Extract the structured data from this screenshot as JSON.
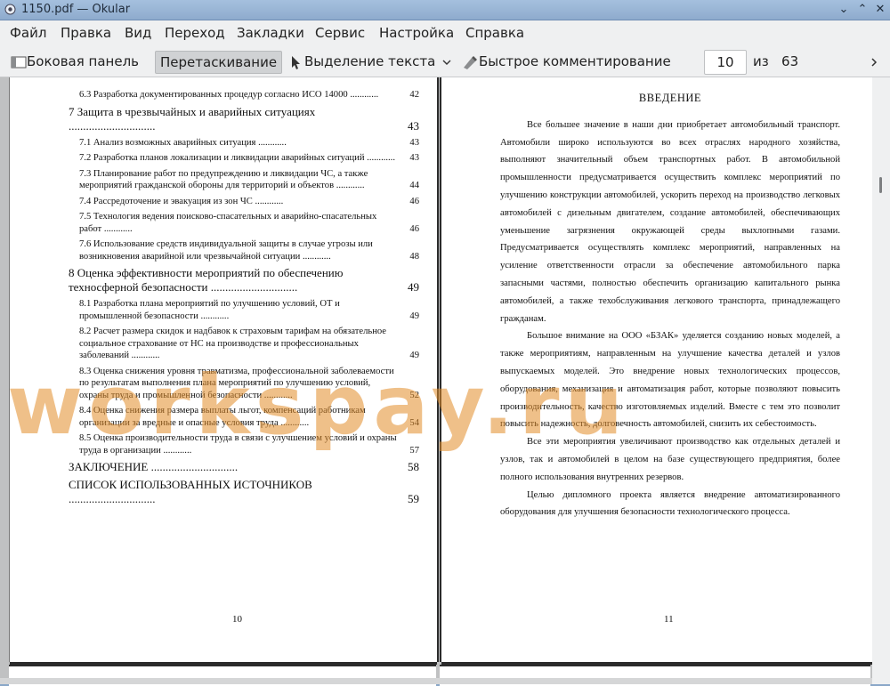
{
  "window": {
    "title": "1150.pdf — Okular"
  },
  "menu": [
    "Файл",
    "Правка",
    "Вид",
    "Переход",
    "Закладки",
    "Сервис",
    "Настройка",
    "Справка"
  ],
  "toolbar": {
    "sidebar": "Боковая панель",
    "drag": "Перетаскивание",
    "select_text": "Выделение текста",
    "quick_comment": "Быстрое комментирование",
    "current_page": "10",
    "of_label": "из",
    "total_pages": "63"
  },
  "left_page": {
    "page_number": "10",
    "toc": [
      {
        "text": "6.3  Разработка документированных процедур согласно ИСО 14000",
        "page": "42",
        "level": 2
      },
      {
        "text": "7   Защита в чрезвычайных и аварийных ситуациях",
        "page": "43",
        "level": 1
      },
      {
        "text": "7.1   Анализ возможных аварийных ситуация",
        "page": "43",
        "level": 2
      },
      {
        "text": "7.2   Разработка планов локализации и ликвидации аварийных ситуаций",
        "page": "43",
        "level": 2
      },
      {
        "text": "7.3   Планирование работ по предупреждению и ликвидации ЧС, а также мероприятий гражданской обороны для территорий и объектов",
        "page": "44",
        "level": 2
      },
      {
        "text": "7.4   Рассредоточение и эвакуация из зон ЧС",
        "page": "46",
        "level": 2
      },
      {
        "text": "7.5   Технология ведения поисково-спасательных и аварийно-спасательных работ",
        "page": "46",
        "level": 2
      },
      {
        "text": "7.6   Использование средств индивидуальной защиты в случае угрозы или возникновения аварийной или чрезвычайной ситуации",
        "page": "48",
        "level": 2
      },
      {
        "text": "8   Оценка эффективности мероприятий по обеспечению техносферной безопасности",
        "page": "49",
        "level": 1
      },
      {
        "text": "8.1   Разработка плана мероприятий по улучшению условий, ОТ и промышленной безопасности",
        "page": "49",
        "level": 2
      },
      {
        "text": "8.2   Расчет размера скидок и надбавок к страховым тарифам на обязательное социальное страхование от НС на производстве и профессиональных заболеваний",
        "page": "49",
        "level": 2
      },
      {
        "text": "8.3      Оценка снижения уровня травматизма, профессиональной заболеваемости по результатам выполнения плана мероприятий по улучшению условий, охраны труда и промышленной безопасности",
        "page": "52",
        "level": 2
      },
      {
        "text": "8.4   Оценка снижения размера выплаты льгот, компенсаций работникам организации за вредные и опасные условия труда",
        "page": "54",
        "level": 2
      },
      {
        "text": "8.5      Оценка производительности труда в связи с улучшением условий и охраны труда в организации",
        "page": "57",
        "level": 2
      },
      {
        "text": "ЗАКЛЮЧЕНИЕ",
        "page": "58",
        "level": 0
      },
      {
        "text": "СПИСОК ИСПОЛЬЗОВАННЫХ ИСТОЧНИКОВ",
        "page": "59",
        "level": 0
      }
    ]
  },
  "right_page": {
    "page_number": "11",
    "heading": "ВВЕДЕНИЕ",
    "paragraphs": [
      "Все большее значение в наши дни приобретает автомобильный транспорт. Автомобили широко используются во всех отраслях народного хозяйства, выполняют значительный объем транспортных работ. В автомобильной промышленности предусматривается осуществить комплекс мероприятий по улучшению конструкции автомобилей, ускорить переход на производство легковых автомобилей с дизельным двигателем, создание автомобилей, обеспечивающих уменьшение загрязнения окружающей среды выхлопными газами. Предусматривается осуществлять комплекс мероприятий, направленных на усиление ответственности отрасли за обеспечение автомобильного парка запасными частями, полностью обеспечить организацию капитального рынка автомобилей, а также техобслуживания легкового транспорта, принадлежащего гражданам.",
      "Большое внимание на ООО «БЗАК» уделяется созданию новых моделей, а также мероприятиям, направленным на улучшение качества деталей и узлов выпускаемых моделей. Это внедрение новых технологических процессов, оборудования, механизация и автоматизация работ, которые позволяют повысить производительность, качество изготовляемых изделий. Вместе с тем это позволит повысить надежность, долговечность автомобилей, снизить их себестоимость.",
      "Все эти мероприятия увеличивают производство как отдельных деталей и узлов, так и автомобилей в целом на базе существующего предприятия, более полного использования внутренних резервов.",
      "Целью дипломного проекта является внедрение автоматизированного оборудования для улучшения безопасности технологического процесса."
    ]
  },
  "watermark": "worksp­ay.ru"
}
